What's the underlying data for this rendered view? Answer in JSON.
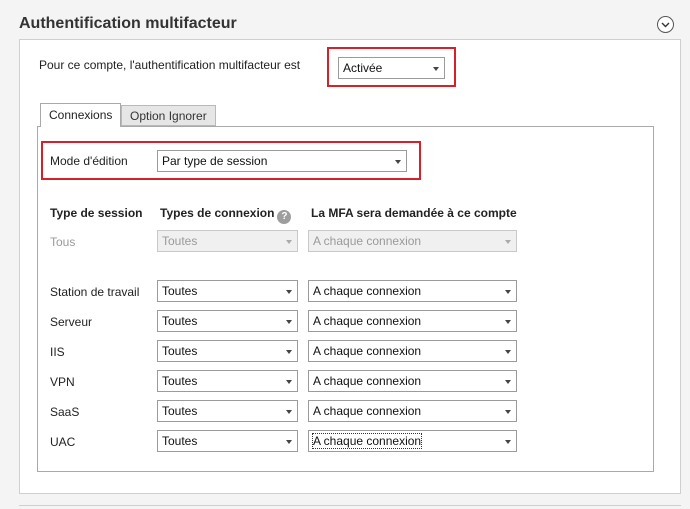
{
  "section": {
    "title": "Authentification multifacteur"
  },
  "account_mfa": {
    "label": "Pour ce compte, l'authentification multifacteur est",
    "value": "Activée"
  },
  "tabs": [
    {
      "label": "Connexions"
    },
    {
      "label": "Option Ignorer"
    }
  ],
  "edit_mode": {
    "label": "Mode d'édition",
    "value": "Par type de session"
  },
  "table": {
    "headers": {
      "session_type": "Type de session",
      "connection_types": "Types de connexion",
      "mfa_required": "La MFA sera demandée à ce compte"
    },
    "all_row": {
      "label": "Tous",
      "connection": "Toutes",
      "mfa": "A chaque connexion"
    },
    "rows": [
      {
        "label": "Station de travail",
        "connection": "Toutes",
        "mfa": "A chaque connexion"
      },
      {
        "label": "Serveur",
        "connection": "Toutes",
        "mfa": "A chaque connexion"
      },
      {
        "label": "IIS",
        "connection": "Toutes",
        "mfa": "A chaque connexion"
      },
      {
        "label": "VPN",
        "connection": "Toutes",
        "mfa": "A chaque connexion"
      },
      {
        "label": "SaaS",
        "connection": "Toutes",
        "mfa": "A chaque connexion"
      },
      {
        "label": "UAC",
        "connection": "Toutes",
        "mfa": "A chaque connexion"
      }
    ]
  },
  "icons": {
    "collapse": "chevron-down-circle-icon",
    "help": "question-circle-icon",
    "dropdown": "caret-down-icon"
  },
  "colors": {
    "highlight": "#d6202a",
    "panel_border": "#cfcfcf",
    "disabled_text": "#9a9a9a"
  }
}
